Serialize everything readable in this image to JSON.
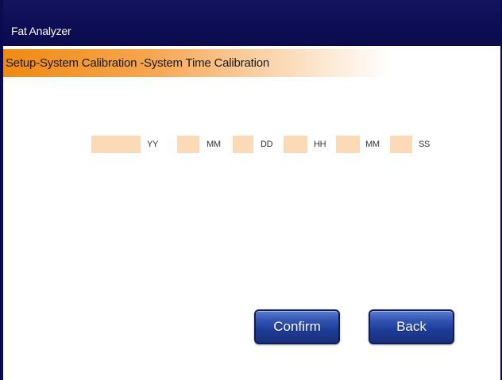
{
  "window": {
    "title": "Fat Analyzer"
  },
  "header": {
    "breadcrumb": "Setup-System Calibration -System Time Calibration"
  },
  "time_fields": [
    {
      "unit": "YY",
      "value": ""
    },
    {
      "unit": "MM",
      "value": ""
    },
    {
      "unit": "DD",
      "value": ""
    },
    {
      "unit": "HH",
      "value": ""
    },
    {
      "unit": "MM",
      "value": ""
    },
    {
      "unit": "SS",
      "value": ""
    }
  ],
  "buttons": {
    "confirm_label": "Confirm",
    "back_label": "Back"
  },
  "colors": {
    "title_bar": "#0d0d55",
    "accent_orange": "#f08a12",
    "field_fill": "#fcd9b7",
    "button_blue": "#1d3c99"
  }
}
